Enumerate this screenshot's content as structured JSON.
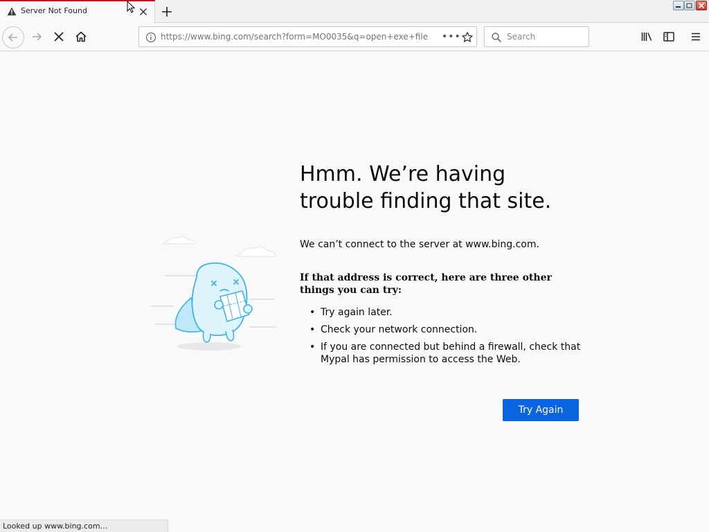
{
  "window": {
    "tab_title": "Server Not Found",
    "controls": [
      "minimize-icon",
      "restore-icon",
      "close-icon"
    ]
  },
  "toolbar": {
    "url": "https://www.bing.com/search?form=MO0035&q=open+exe+file",
    "search_placeholder": "Search",
    "page_actions_label": "•••"
  },
  "error_page": {
    "title": "Hmm. We’re having trouble finding that site.",
    "description": "We can’t connect to the server at www.bing.com.",
    "suggestions_heading": "If that address is correct, here are three other things you can try:",
    "suggestions": [
      "Try again later.",
      "Check your network connection.",
      "If you are connected but behind a firewall, check that Mypal has permission to access the Web."
    ],
    "try_again_label": "Try Again"
  },
  "status_bar": {
    "text": "Looked up www.bing.com…"
  },
  "colors": {
    "accent_button": "#0a64df",
    "loading_line": "#b01e1e",
    "page_background": "#f9f9fa",
    "illustration_fill": "#dff3fc",
    "illustration_stroke": "#3fb3e6"
  }
}
